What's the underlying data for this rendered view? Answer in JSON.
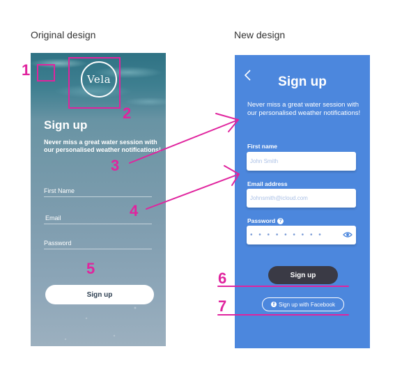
{
  "captions": {
    "original": "Original design",
    "new": "New design"
  },
  "original": {
    "logo_text": "Vela",
    "title": "Sign up",
    "subtitle": "Never miss a great water session with our personalised weather notifications!",
    "fields": [
      "First Name",
      "Email",
      "Password"
    ],
    "button": "Sign up"
  },
  "new_design": {
    "title": "Sign up",
    "subtitle": "Never miss a great water session with our personalised weather notifications!",
    "fields": [
      {
        "label": "First name",
        "placeholder": "John Smith"
      },
      {
        "label": "Email address",
        "placeholder": "Johnsmith@icloud.com"
      },
      {
        "label": "Password",
        "value": "• • • • • • • • •"
      }
    ],
    "password_help": "?",
    "signup_button": "Sign up",
    "facebook_button": "Sign up with Facebook",
    "facebook_icon_glyph": "f"
  },
  "annotations": [
    "1",
    "2",
    "3",
    "4",
    "5",
    "6",
    "7"
  ],
  "colors": {
    "annotation": "#e0249e",
    "new_bg": "#4c87dd",
    "dark_button": "#3a3a45"
  },
  "icons": [
    "back-chevron-icon",
    "help-icon",
    "eye-icon",
    "facebook-icon"
  ]
}
